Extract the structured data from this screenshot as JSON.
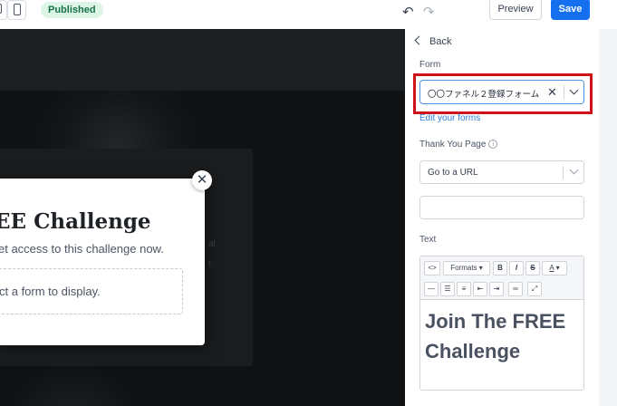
{
  "topbar": {
    "status_badge": "Published",
    "preview_label": "Preview",
    "save_label": "Save",
    "undo_icon": "↶",
    "redo_icon": "↷"
  },
  "canvas": {
    "popup": {
      "title": "EE Challenge",
      "subtitle": "et access to this challenge now.",
      "placeholder": "ct a form to display.",
      "close_icon": "✕"
    },
    "ghost_text": [
      "al",
      "t"
    ]
  },
  "panel": {
    "back_label": "Back",
    "form_label": "Form",
    "form_value": "〇〇ファネル２登録フォーム",
    "clear_icon": "✕",
    "edit_forms_link": "Edit your forms",
    "thank_you_label": "Thank You Page",
    "info_icon": "i",
    "thank_you_value": "Go to a URL",
    "url_value": "",
    "text_label": "Text",
    "editor": {
      "toolbar": {
        "code": "<>",
        "formats": "Formats",
        "bold": "B",
        "italic": "I",
        "strike": "S",
        "font_color": "A"
      },
      "content": "Join The FREE Challenge"
    }
  },
  "colors": {
    "accent": "#1570ef",
    "highlight": "#d0121b",
    "badge_bg": "#dcf5e7",
    "badge_text": "#177245"
  }
}
